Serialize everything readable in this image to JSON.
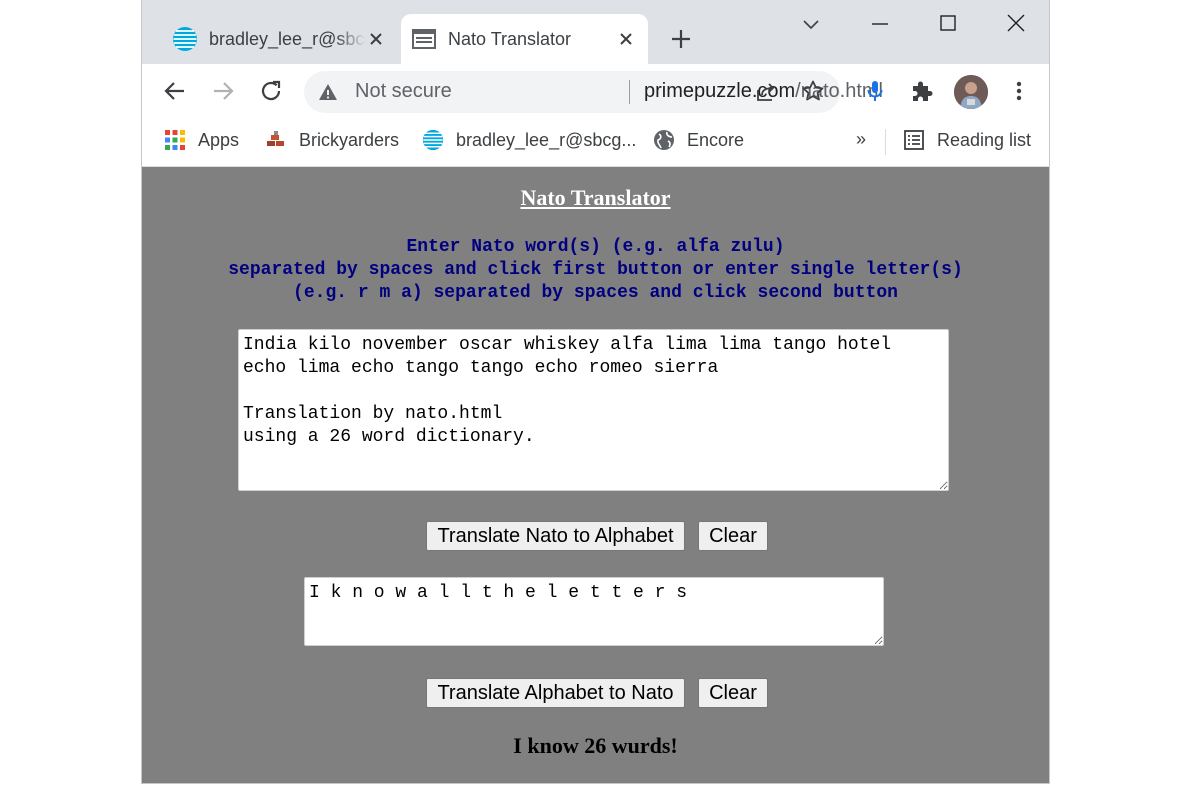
{
  "browser": {
    "tabs": [
      {
        "title": "bradley_lee_r@sbcglobal.net",
        "favicon": "att-globe-icon",
        "active": false
      },
      {
        "title": "Nato Translator",
        "favicon": "page-icon",
        "active": true
      }
    ],
    "omnibox": {
      "security_label": "Not secure",
      "url_host": "primepuzzle.com",
      "url_path": "/nato.html"
    },
    "bookmarks": [
      {
        "label": "Apps",
        "icon": "apps-grid-icon"
      },
      {
        "label": "Brickyarders",
        "icon": "brick-icon"
      },
      {
        "label": "bradley_lee_r@sbcg...",
        "icon": "att-globe-icon"
      },
      {
        "label": "Encore",
        "icon": "globe-icon"
      }
    ],
    "bookmarks_overflow": "»",
    "reading_list_label": "Reading list"
  },
  "page": {
    "title": "Nato Translator",
    "instructions": [
      "Enter Nato word(s) (e.g. alfa zulu)",
      "separated by spaces and click first button or enter single letter(s)",
      "(e.g. r m a) separated by spaces and click second button"
    ],
    "nato_input_value": "India kilo november oscar whiskey alfa lima lima tango hotel\necho lima echo tango tango echo romeo sierra\n\nTranslation by nato.html\nusing a 26 word dictionary.",
    "translate_to_alphabet_label": "Translate Nato to Alphabet",
    "clear_label_1": "Clear",
    "alphabet_input_value": "I k n o w a l l t h e l e t t e r s",
    "translate_to_nato_label": "Translate Alphabet to Nato",
    "clear_label_2": "Clear",
    "footer": "I know 26 wurds!"
  },
  "colors": {
    "page_background": "#808080",
    "instruction_text": "#000080",
    "title_text": "#ffffff"
  }
}
